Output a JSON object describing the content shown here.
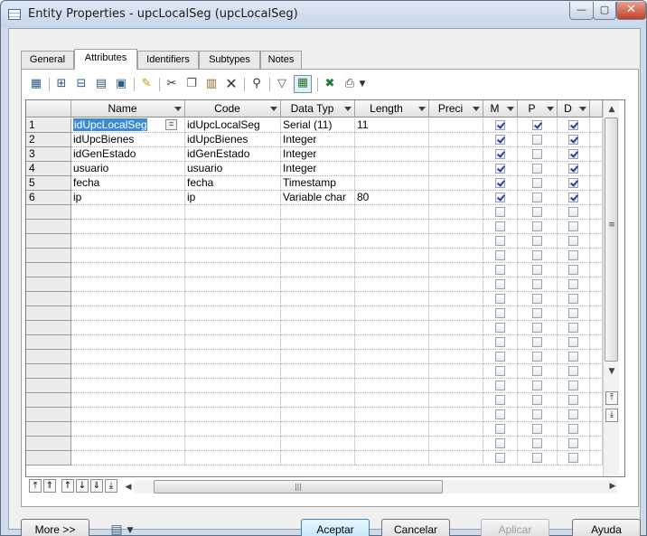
{
  "window": {
    "title": "Entity Properties - upcLocalSeg (upcLocalSeg)",
    "controls": {
      "minimize": "—",
      "maximize": "▢",
      "close": "✕"
    }
  },
  "tabs": [
    {
      "label": "General",
      "active": false
    },
    {
      "label": "Attributes",
      "active": true
    },
    {
      "label": "Identifiers",
      "active": false
    },
    {
      "label": "Subtypes",
      "active": false
    },
    {
      "label": "Notes",
      "active": false
    }
  ],
  "grid": {
    "columns": [
      {
        "label": "Name"
      },
      {
        "label": "Code"
      },
      {
        "label": "Data Typ"
      },
      {
        "label": "Length"
      },
      {
        "label": "Preci"
      },
      {
        "label": "M"
      },
      {
        "label": "P"
      },
      {
        "label": "D"
      }
    ],
    "rows": [
      {
        "num": "1",
        "name": "idUpcLocalSeg",
        "code": "idUpcLocalSeg",
        "type": "Serial (11)",
        "length": "11",
        "m": true,
        "p": true,
        "d": true
      },
      {
        "num": "2",
        "name": "idUpcBienes",
        "code": "idUpcBienes",
        "type": "Integer",
        "length": "",
        "m": true,
        "p": false,
        "d": true
      },
      {
        "num": "3",
        "name": "idGenEstado",
        "code": "idGenEstado",
        "type": "Integer",
        "length": "",
        "m": true,
        "p": false,
        "d": true
      },
      {
        "num": "4",
        "name": "usuario",
        "code": "usuario",
        "type": "Integer",
        "length": "",
        "m": true,
        "p": false,
        "d": true
      },
      {
        "num": "5",
        "name": "fecha",
        "code": "fecha",
        "type": "Timestamp",
        "length": "",
        "m": true,
        "p": false,
        "d": true
      },
      {
        "num": "6",
        "name": "ip",
        "code": "ip",
        "type": "Variable char",
        "length": "80",
        "m": true,
        "p": false,
        "d": true
      }
    ],
    "ellipsis_button": "="
  },
  "buttons": {
    "more": "More >>",
    "accept": "Aceptar",
    "cancel": "Cancelar",
    "apply": "Aplicar",
    "help": "Ayuda"
  },
  "colors": {
    "selection": "#3a8ad6",
    "titlebar": "#cfdbe9"
  }
}
